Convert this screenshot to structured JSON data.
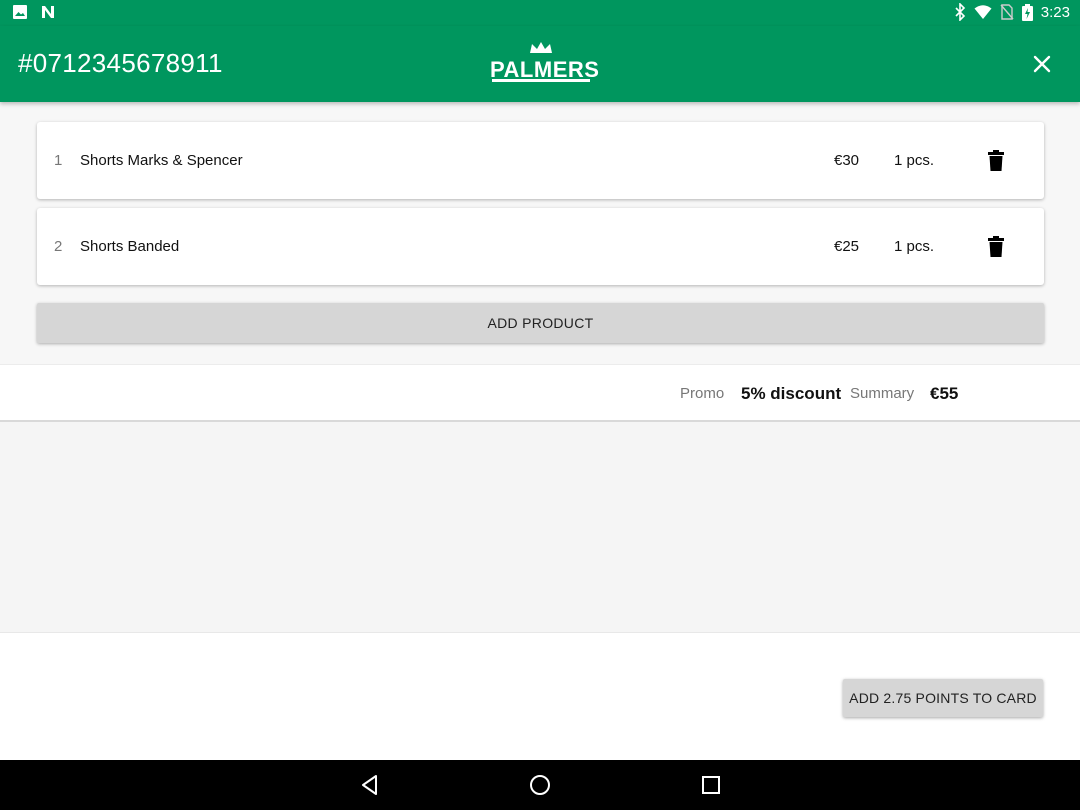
{
  "status_bar": {
    "time": "3:23",
    "left_icons": [
      "image-icon",
      "n-notification-icon"
    ],
    "right_icons": [
      "bluetooth-icon",
      "wifi-icon",
      "no-sim-icon",
      "battery-charging-icon"
    ]
  },
  "app_bar": {
    "title": "#0712345678911",
    "logo_text": "PALMERS",
    "close_icon": "close-icon",
    "color": "#00965e"
  },
  "products": [
    {
      "index": "1",
      "name": "Shorts Marks & Spencer",
      "price": "€30",
      "qty": "1 pcs."
    },
    {
      "index": "2",
      "name": "Shorts Banded",
      "price": "€25",
      "qty": "1 pcs."
    }
  ],
  "add_product_label": "ADD PRODUCT",
  "summary": {
    "promo_label": "Promo",
    "promo_value": "5% discount",
    "summary_label": "Summary",
    "summary_value": "€55"
  },
  "points_button_label": "ADD 2.75 POINTS TO CARD",
  "nav_bar": {
    "icons": [
      "back-icon",
      "home-icon",
      "recents-icon"
    ]
  }
}
